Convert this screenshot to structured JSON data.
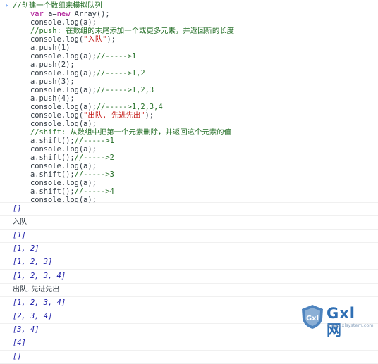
{
  "console": {
    "prompt_symbol": "›",
    "input_lines": [
      [
        {
          "t": "//创建一个数组来模拟队列",
          "c": "c-comment cjkmix"
        }
      ],
      [
        {
          "t": "    "
        },
        {
          "t": "var",
          "c": "c-kw"
        },
        {
          "t": " a="
        },
        {
          "t": "new",
          "c": "c-kw"
        },
        {
          "t": " Array();"
        }
      ],
      [
        {
          "t": "    console.log(a);"
        }
      ],
      [
        {
          "t": "    "
        },
        {
          "t": "//push: 在数组的末尾添加一个或更多元素，并返回新的长度",
          "c": "c-comment"
        }
      ],
      [
        {
          "t": "    console.log("
        },
        {
          "t": "\"入队\"",
          "c": "c-str"
        },
        {
          "t": ");"
        }
      ],
      [
        {
          "t": "    a.push(1)"
        }
      ],
      [
        {
          "t": "    console.log(a);"
        },
        {
          "t": "//----->1",
          "c": "c-comment"
        }
      ],
      [
        {
          "t": "    a.push(2);"
        }
      ],
      [
        {
          "t": "    console.log(a);"
        },
        {
          "t": "//----->1,2",
          "c": "c-comment"
        }
      ],
      [
        {
          "t": "    a.push(3);"
        }
      ],
      [
        {
          "t": "    console.log(a);"
        },
        {
          "t": "//----->1,2,3",
          "c": "c-comment"
        }
      ],
      [
        {
          "t": "    a.push(4);"
        }
      ],
      [
        {
          "t": "    console.log(a);"
        },
        {
          "t": "//----->1,2,3,4",
          "c": "c-comment"
        }
      ],
      [
        {
          "t": "    console.log("
        },
        {
          "t": "\"出队, 先进先出\"",
          "c": "c-str"
        },
        {
          "t": ");"
        }
      ],
      [
        {
          "t": "    console.log(a);"
        }
      ],
      [
        {
          "t": "    "
        },
        {
          "t": "//shift: 从数组中把第一个元素删除，并返回这个元素的值",
          "c": "c-comment"
        }
      ],
      [
        {
          "t": "    a.shift();"
        },
        {
          "t": "//----->1",
          "c": "c-comment"
        }
      ],
      [
        {
          "t": "    console.log(a);"
        }
      ],
      [
        {
          "t": "    a.shift();"
        },
        {
          "t": "//----->2",
          "c": "c-comment"
        }
      ],
      [
        {
          "t": "    console.log(a);"
        }
      ],
      [
        {
          "t": "    a.shift();"
        },
        {
          "t": "//----->3",
          "c": "c-comment"
        }
      ],
      [
        {
          "t": "    console.log(a);"
        }
      ],
      [
        {
          "t": "    a.shift();"
        },
        {
          "t": "//----->4",
          "c": "c-comment"
        }
      ],
      [
        {
          "t": "    console.log(a);"
        }
      ]
    ],
    "output_rows": [
      {
        "text": "[]",
        "kind": "arr"
      },
      {
        "text": "入队",
        "kind": "txt"
      },
      {
        "text": "[1]",
        "kind": "arr"
      },
      {
        "text": "[1, 2]",
        "kind": "arr"
      },
      {
        "text": "[1, 2, 3]",
        "kind": "arr"
      },
      {
        "text": "[1, 2, 3, 4]",
        "kind": "arr"
      },
      {
        "text": "出队, 先进先出",
        "kind": "txt"
      },
      {
        "text": "[1, 2, 3, 4]",
        "kind": "arr"
      },
      {
        "text": "[2, 3, 4]",
        "kind": "arr"
      },
      {
        "text": "[3, 4]",
        "kind": "arr"
      },
      {
        "text": "[4]",
        "kind": "arr"
      },
      {
        "text": "[]",
        "kind": "arr"
      }
    ]
  },
  "watermark": {
    "word": "Gxl 网",
    "url": "www.gxlsystem.com",
    "colors": {
      "primary": "#2f6fb4",
      "secondary": "#8aa2bd"
    }
  },
  "colors": {
    "comment": "#236e25",
    "keyword": "#aa0d91",
    "string": "#c41a16",
    "array_output": "#1a1aa6",
    "prompt": "#367cf1",
    "divider": "#f0f0f0"
  }
}
